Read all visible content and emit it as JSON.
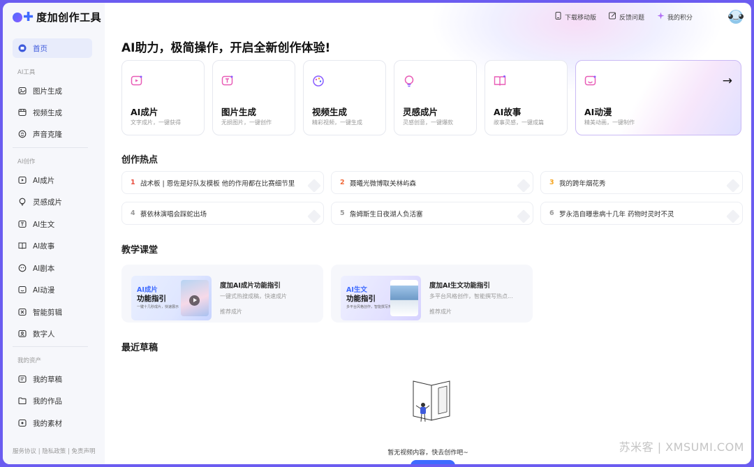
{
  "app": {
    "title": "度加创作工具"
  },
  "topbar": {
    "download": "下载移动版",
    "feedback": "反馈问题",
    "points": "我的积分"
  },
  "sidebar": {
    "home": "首页",
    "section_ai_tools": "AI工具",
    "tools": [
      "图片生成",
      "视频生成",
      "声音克隆"
    ],
    "section_ai_create": "AI创作",
    "create": [
      "AI成片",
      "灵感成片",
      "AI生文",
      "AI故事",
      "AI剧本",
      "AI动漫",
      "智能剪辑",
      "数字人"
    ],
    "section_assets": "我的资产",
    "assets": [
      "我的草稿",
      "我的作品",
      "我的素材"
    ],
    "footer": "服务协议 | 隐私政策 | 免责声明"
  },
  "main": {
    "headline": "AI助力，极简操作，开启全新创作体验!",
    "tool_cards": [
      {
        "title": "AI成片",
        "sub": "文字成片，一键获得",
        "icon": "film-icon"
      },
      {
        "title": "图片生成",
        "sub": "无损图片，一键创作",
        "icon": "image-icon"
      },
      {
        "title": "视频生成",
        "sub": "精彩视频，一键生成",
        "icon": "palette-icon"
      },
      {
        "title": "灵感成片",
        "sub": "灵感创意，一键爆款",
        "icon": "bulb-icon"
      },
      {
        "title": "AI故事",
        "sub": "故事灵感，一键成篇",
        "icon": "book-icon"
      },
      {
        "title": "AI动漫",
        "sub": "精美动画，一键制作",
        "icon": "smile-icon"
      }
    ],
    "hot_title": "创作热点",
    "hot_items": [
      {
        "rank": "1",
        "text": "战术板 | 恩佐是好队友模板 他的作用都在比赛细节里"
      },
      {
        "rank": "2",
        "text": "聂曦光微博取关林屿森"
      },
      {
        "rank": "3",
        "text": "我的跨年烟花秀"
      },
      {
        "rank": "4",
        "text": "蔡依林演唱会踩蛇出场"
      },
      {
        "rank": "5",
        "text": "詹姆斯生日夜湖人负活塞"
      },
      {
        "rank": "6",
        "text": "罗永浩自曝患病十几年 药物时灵时不灵"
      }
    ],
    "course_title": "教学课堂",
    "courses": [
      {
        "thumb_tag": "AI成片",
        "thumb_title": "功能指引",
        "thumb_caption": "一键十几秒成片，快速展示",
        "title": "度加AI成片功能指引",
        "desc": "一键式热搜成稿，快速成片",
        "tag": "推荐成片"
      },
      {
        "thumb_tag": "AI生文",
        "thumb_title": "功能指引",
        "thumb_caption": "多平台风格创作，智能撰写热点",
        "title": "度加AI生文功能指引",
        "desc": "多平台风格创作，智能撰写热点...",
        "tag": "推荐成片"
      }
    ],
    "drafts_title": "最近草稿",
    "empty_text": "暂无视频内容，快去创作吧~"
  },
  "watermark": "苏米客 | XMSUMI.COM",
  "colors": {
    "accent": "#3f6bff",
    "sidebar_bg": "#f6f7fb",
    "frame": "#6b5cf0"
  }
}
